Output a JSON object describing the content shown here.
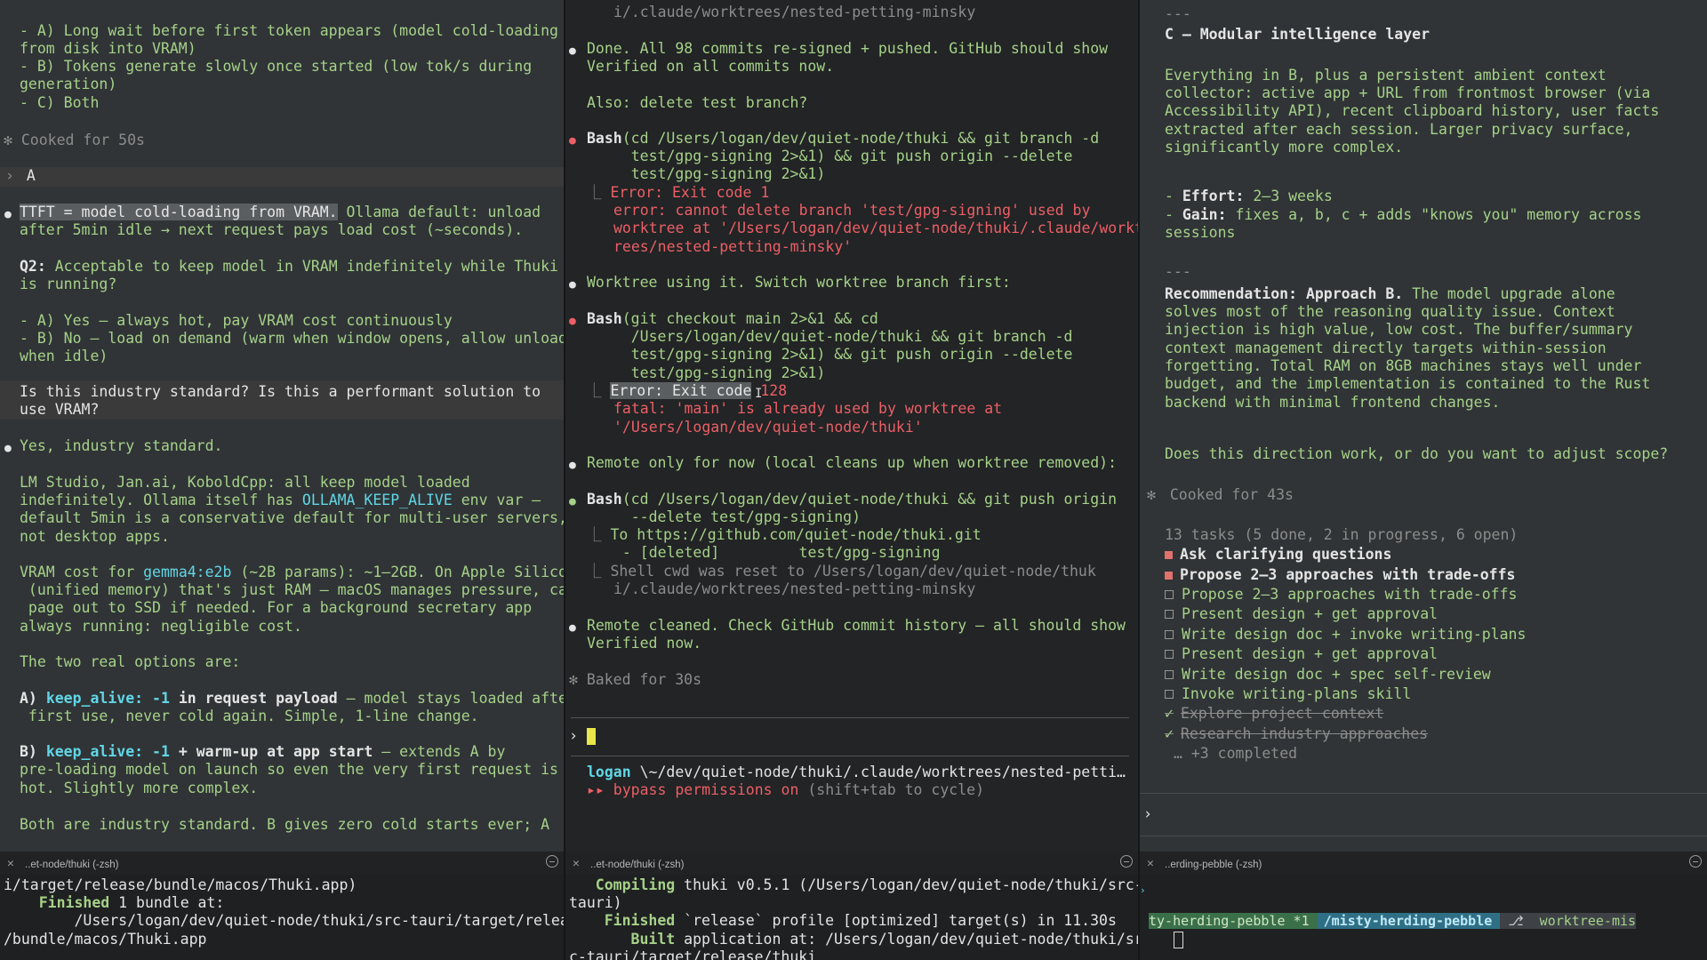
{
  "pane1": {
    "lines": [
      "- A) Long wait before first token appears (model cold-loading",
      "from disk into VRAM)",
      "- B) Tokens generate slowly once started (low tok/s during",
      "generation)",
      "- C) Both",
      "",
      "Cooked for 50s",
      "",
      "A",
      "",
      "TTFT = model cold-loading from VRAM.",
      " Ollama default: unload",
      "after 5min idle → next request pays load cost (~seconds).",
      "",
      "Q2: ",
      "Acceptable to keep model in VRAM indefinitely while Thuki",
      "is running?",
      "",
      "- A) Yes — always hot, pay VRAM cost continuously",
      "- B) No — load on demand (warm when window opens, allow unload",
      "when idle)",
      "",
      "Is this industry standard? Is this a performant solution to",
      "use VRAM?",
      "",
      "Yes, industry standard.",
      "",
      "LM Studio, Jan.ai, KoboldCpp: all keep model loaded",
      "indefinitely. Ollama itself has ",
      "OLLAMA_KEEP_ALIVE",
      " env var —",
      "default 5min is a conservative default for multi-user servers,",
      "not desktop apps.",
      "",
      "VRAM cost for ",
      "gemma4:e2b",
      " (~2B params): ~1–2GB. On Apple Silicon",
      " (unified memory) that's just RAM — macOS manages pressure, can",
      " page out to SSD if needed. For a background secretary app",
      "always running: negligible cost.",
      "",
      "The two real options are:",
      "",
      "A) ",
      "keep_alive: -1",
      " in request payload",
      " — model stays loaded after",
      " first use, never cold again. Simple, 1-line change.",
      "",
      "B) ",
      "keep_alive: -1",
      " + warm-up at app start",
      " — extends A by",
      "pre-loading model on launch so even the very first request is",
      "hot. Slightly more complex.",
      "",
      "Both are industry standard. B gives zero cold starts ever; A"
    ]
  },
  "pane2": {
    "lines": [
      "i/.claude/worktrees/nested-petting-minsky",
      "",
      "Done. All 98 commits re-signed + pushed. GitHub should show",
      "Verified on all commits now.",
      "",
      "Also: delete test branch?",
      "",
      "Bash",
      "(cd /Users/logan/dev/quiet-node/thuki && git branch -d",
      "    test/gpg-signing 2>&1) && git push origin --delete",
      "    test/gpg-signing 2>&1)",
      "Error: Exit code 1",
      "error: cannot delete branch 'test/gpg-signing' used by",
      "worktree at '/Users/logan/dev/quiet-node/thuki/.claude/workt",
      "rees/nested-petting-minsky'",
      "",
      "Worktree using it. Switch worktree branch first:",
      "",
      "Bash",
      "(git checkout main 2>&1 && cd",
      "    /Users/logan/dev/quiet-node/thuki && git branch -d",
      "    test/gpg-signing 2>&1) && git push origin --delete",
      "    test/gpg-signing 2>&1)",
      "Error: Exit code",
      " 128",
      "fatal: 'main' is already used by worktree at",
      "'/Users/logan/dev/quiet-node/thuki'",
      "",
      "Remote only for now (local cleans up when worktree removed):",
      "",
      "Bash",
      "(cd /Users/logan/dev/quiet-node/thuki && git push origin",
      "    --delete test/gpg-signing)",
      "To https://github.com/quiet-node/thuki.git",
      " - [deleted]         test/gpg-signing",
      "Shell cwd was reset to /Users/logan/dev/quiet-node/thuk",
      "i/.claude/worktrees/nested-petting-minsky",
      "",
      "Remote cleaned. Check GitHub commit history — all should show",
      "Verified now.",
      "",
      "Baked for 30s",
      "logan",
      " \\~/dev/quiet-node/thuki/.claude/worktrees/nested-petti…",
      "▸▸ bypass permissions on",
      " (shift+tab to cycle)"
    ]
  },
  "pane3": {
    "lines": [
      "---",
      "C — Modular intelligence layer",
      "",
      "Everything in B, plus a persistent ambient context",
      "collector: active app + URL from frontmost browser (via",
      "Accessibility API), recent clipboard history, user facts",
      "extracted after each session. Larger privacy surface,",
      "significantly more complex.",
      "",
      "- ",
      "Effort:",
      " 2–3 weeks",
      "- ",
      "Gain:",
      " fixes a, b, c + adds \"knows you\" memory across",
      "sessions",
      "",
      "---",
      "",
      "Recommendation: Approach B.",
      " The model upgrade alone",
      "solves most of the reasoning quality issue. Context",
      "injection is high value, low cost. The buffer/summary",
      "context management directly targets within-session",
      "forgetting. Total RAM on 8GB machines stays well under",
      "budget, and the implementation is contained to the Rust",
      "backend with minimal frontend changes.",
      "",
      "Does this direction work, or do you want to adjust scope?",
      "",
      "Cooked for 43s",
      "",
      "13 tasks (5 done, 2 in progress, 6 open)",
      "Ask clarifying questions",
      "Propose 2–3 approaches with trade-offs",
      "Propose 2–3 approaches with trade-offs",
      "Present design + get approval",
      "Write design doc + invoke writing-plans",
      "Present design + get approval",
      "Write design doc + spec self-review",
      "Invoke writing-plans skill",
      "Explore project context",
      "Research industry approaches",
      "… +3 completed"
    ]
  },
  "tabs": [
    {
      "title": "..et-node/thuki (-zsh)"
    },
    {
      "title": "..et-node/thuki (-zsh)"
    },
    {
      "title": "..erding-pebble (-zsh)"
    }
  ],
  "bottom1": {
    "lines": [
      "i/target/release/bundle/macos/Thuki.app)",
      "    Finished",
      " 1 bundle at:",
      "        /Users/logan/dev/quiet-node/thuki/src-tauri/target/release",
      "/bundle/macos/Thuki.app"
    ]
  },
  "bottom2": {
    "lines": [
      "   Compiling",
      " thuki v0.5.1 (/Users/logan/dev/quiet-node/thuki/src-",
      "tauri)",
      "    Finished",
      " `release` profile [optimized] target(s) in 11.30s",
      "       Built",
      " application at: /Users/logan/dev/quiet-node/thuki/sr",
      "c-tauri/target/release/thuki"
    ]
  },
  "bottom3": {
    "prompt_path": " ~/ / /thuki/ / /misty-herding-pebble ",
    "prompt_branch": " worktree-mis",
    "line2": "ty-herding-pebble *1 "
  },
  "colors": {
    "green": "#a6d189",
    "red": "#ec5f67",
    "cyan": "#61d6e6",
    "cursor": "#e8e64a"
  }
}
